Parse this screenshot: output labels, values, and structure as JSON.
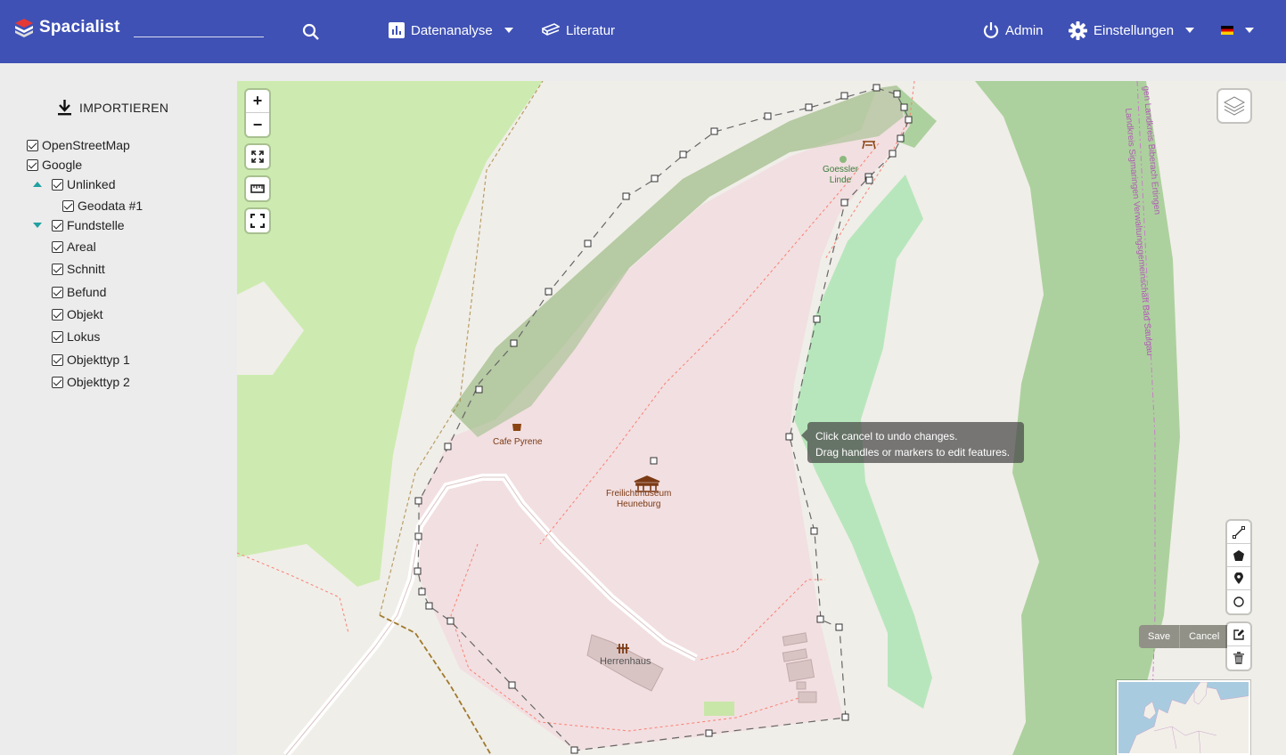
{
  "navbar": {
    "brand": "Spacialist",
    "search_placeholder": "",
    "analysis": "Datenanalyse",
    "literature": "Literatur",
    "admin": "Admin",
    "settings": "Einstellungen",
    "language_flag": "de-flag-icon"
  },
  "sidebar": {
    "import_label": "IMPORTIEREN",
    "layers": [
      {
        "label": "OpenStreetMap",
        "checked": true
      },
      {
        "label": "Google",
        "checked": true
      },
      {
        "label": "Unlinked",
        "checked": true,
        "expanded": true
      },
      {
        "label": "Geodata #1",
        "checked": true
      },
      {
        "label": "Fundstelle",
        "checked": true,
        "expanded": true
      },
      {
        "label": "Areal",
        "checked": true
      },
      {
        "label": "Schnitt",
        "checked": true
      },
      {
        "label": "Befund",
        "checked": true
      },
      {
        "label": "Objekt",
        "checked": true
      },
      {
        "label": "Lokus",
        "checked": true
      },
      {
        "label": "Objekttyp 1",
        "checked": true
      },
      {
        "label": "Objekttyp 2",
        "checked": true
      }
    ]
  },
  "map": {
    "zoom_in": "+",
    "zoom_out": "−",
    "tooltip_line1": "Click cancel to undo changes.",
    "tooltip_line2": "Drag handles or markers to edit features.",
    "save": "Save",
    "cancel": "Cancel",
    "labels": {
      "goessler": [
        "Goessler",
        "Linde"
      ],
      "cafe": "Cafe Pyrene",
      "museum": [
        "Freilichtmuseum",
        "Heuneburg"
      ],
      "herrenhaus": "Herrenhaus",
      "boundary1": "gen Landkreis Biberach Ertingen",
      "boundary2": "Landkreis Sigmaringen Verwaltungsgemeinschaft Bad Saulgau"
    },
    "colors": {
      "navbar": "#3f51b5",
      "forest": "#add19e",
      "park": "#c8facc",
      "farmland": "#cdebb0",
      "museum_area": "#f2dfe1"
    }
  }
}
